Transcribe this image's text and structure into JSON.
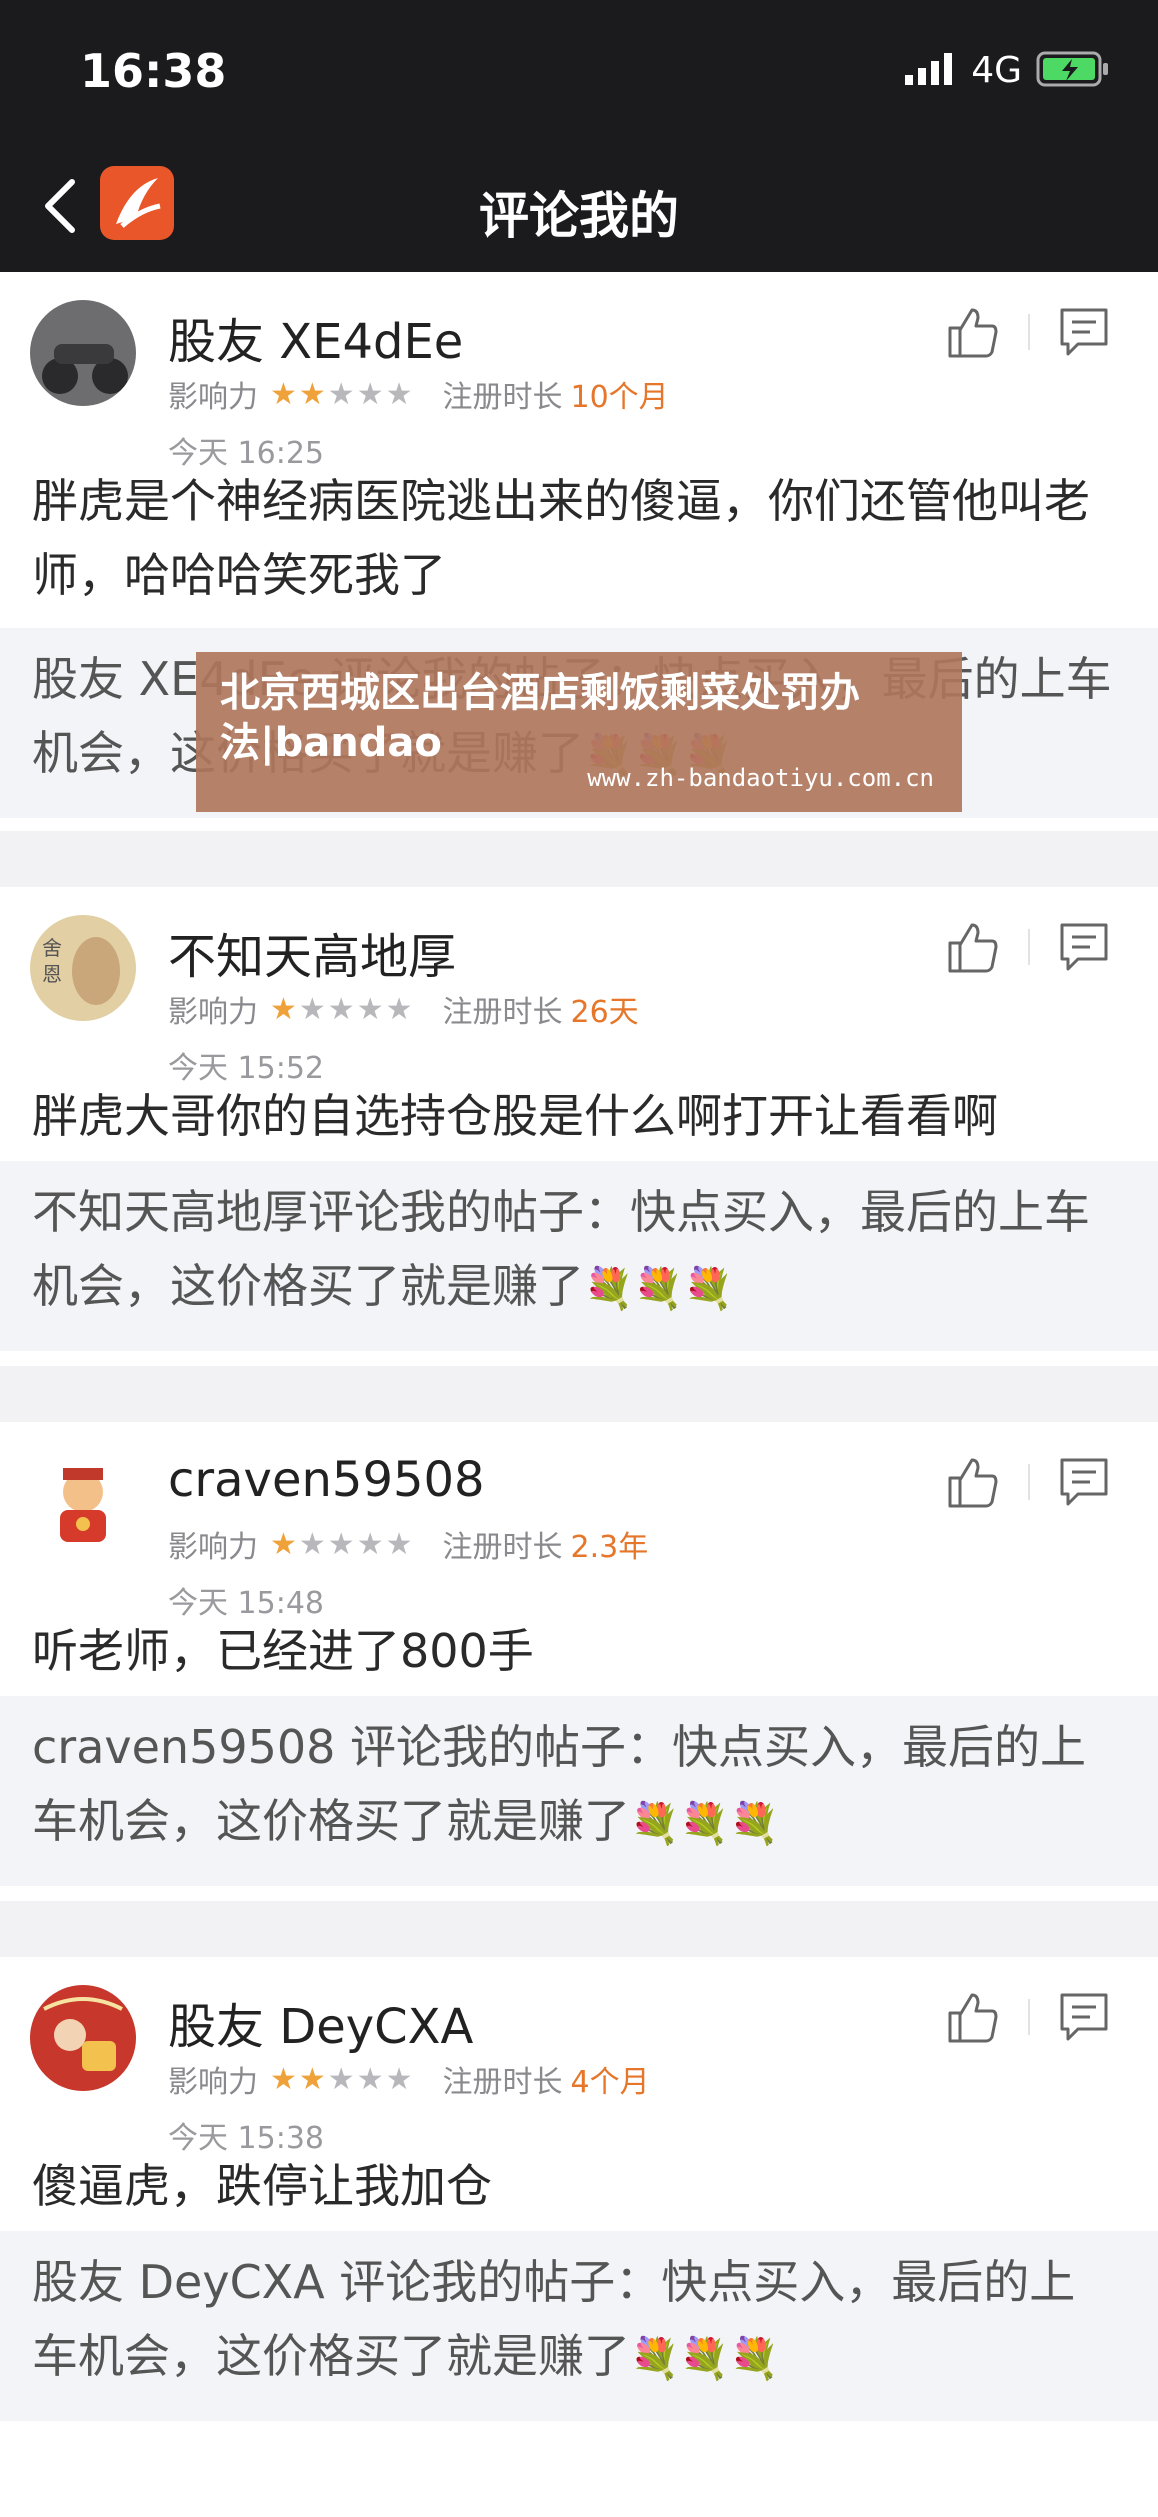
{
  "status_bar": {
    "time": "16:38",
    "network": "4G"
  },
  "header": {
    "title": "评论我的"
  },
  "labels": {
    "influence": "影响力",
    "register": "注册时长"
  },
  "colors": {
    "accent": "#e5762a",
    "star": "#f0a23a",
    "logo": "#e8562a",
    "overlay": "#b0765c"
  },
  "comments": [
    {
      "user": "股友 XE4dEe",
      "stars": 2,
      "reg": "10个月",
      "time": "今天 16:25",
      "text": "胖虎是个神经病医院逃出来的傻逼，你们还管他叫老师，哈哈哈笑死我了",
      "quote": "股友 XE4dEe 评论我的帖子：快点买入，最后的上车机会，这价格买了就是赚了",
      "avatar": "avatar-motorcycle"
    },
    {
      "user": "不知天高地厚",
      "stars": 1,
      "reg": "26天",
      "time": "今天 15:52",
      "text": "胖虎大哥你的自选持仓股是什么啊打开让看看啊",
      "quote": "不知天高地厚评论我的帖子：快点买入，最后的上车机会，这价格买了就是赚了",
      "avatar": "avatar-buddha"
    },
    {
      "user": "craven59508",
      "stars": 1,
      "reg": "2.3年",
      "time": "今天 15:48",
      "text": "听老师，已经进了800手",
      "quote": "craven59508 评论我的帖子：快点买入，最后的上车机会，这价格买了就是赚了",
      "avatar": "avatar-fortune-god"
    },
    {
      "user": "股友 DeyCXA",
      "stars": 2,
      "reg": "4个月",
      "time": "今天 15:38",
      "text": "傻逼虎，跌停让我加仓",
      "quote": "股友 DeyCXA 评论我的帖子：快点买入，最后的上车机会，这价格买了就是赚了",
      "avatar": "avatar-red-festive"
    }
  ],
  "quote_emoji": "💐💐💐",
  "overlay": {
    "text": "北京西城区出台酒店剩饭剩菜处罚办法|bandao",
    "url": "www.zh-bandaotiyu.com.cn"
  }
}
